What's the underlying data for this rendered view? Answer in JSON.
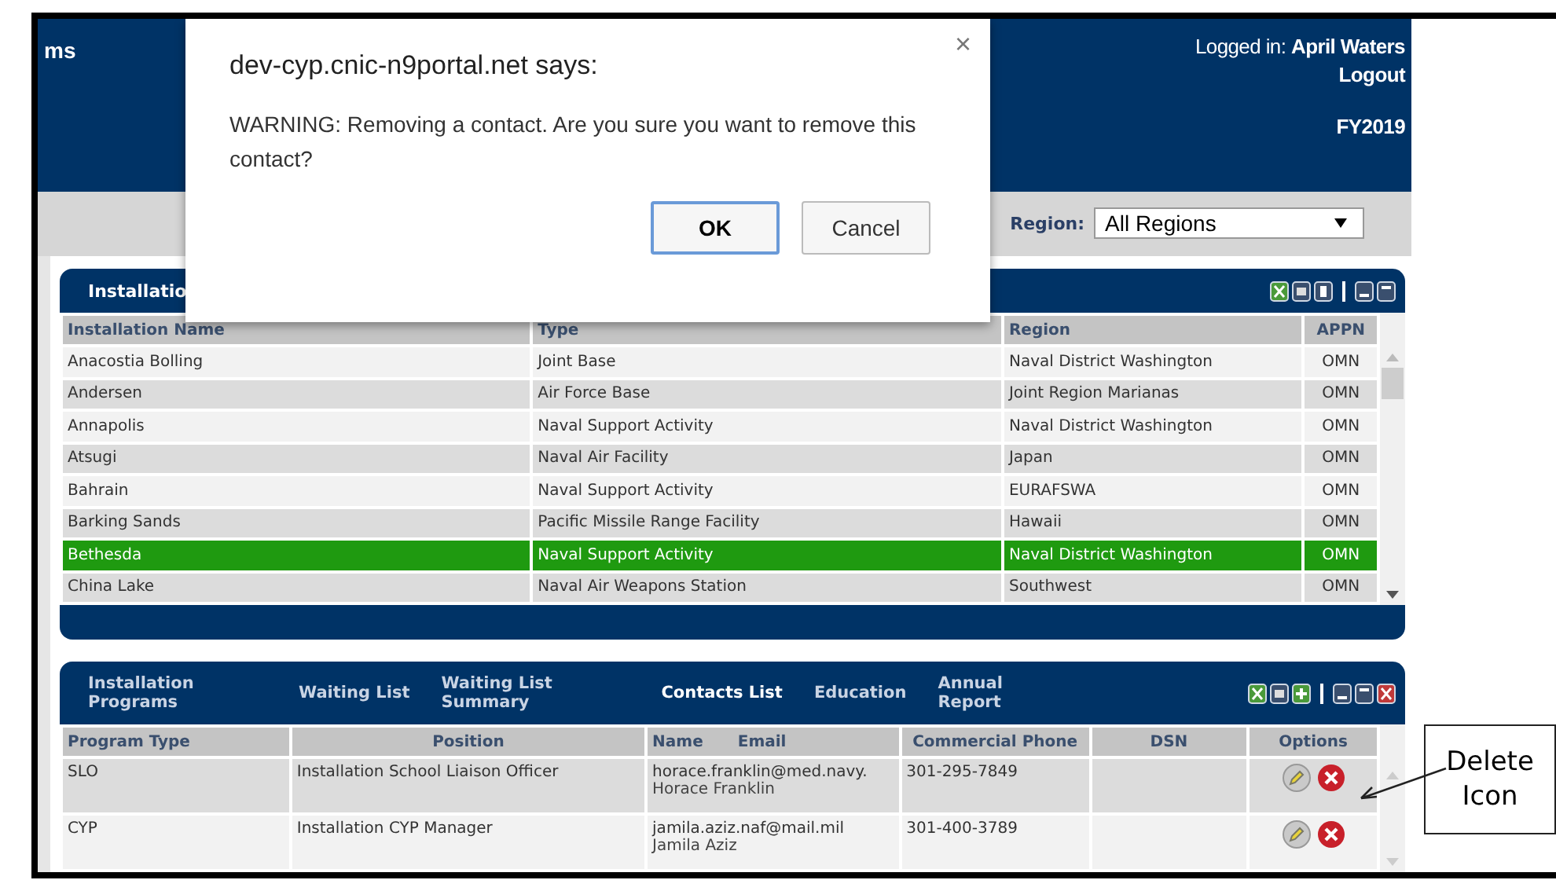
{
  "header": {
    "title_fragment": "ms",
    "logged_in_label": "Logged in:",
    "user": "April Waters",
    "logout": "Logout",
    "fiscal_year": "FY2019"
  },
  "filter": {
    "label": "Region:",
    "value": "All Regions"
  },
  "installations": {
    "tab": "Installatio",
    "columns": [
      "Installation Name",
      "Type",
      "Region",
      "APPN"
    ],
    "rows": [
      {
        "name": "Anacostia Bolling",
        "type": "Joint Base",
        "region": "Naval District Washington",
        "appn": "OMN",
        "selected": false
      },
      {
        "name": "Andersen",
        "type": "Air Force Base",
        "region": "Joint Region Marianas",
        "appn": "OMN",
        "selected": false
      },
      {
        "name": "Annapolis",
        "type": "Naval Support Activity",
        "region": "Naval District Washington",
        "appn": "OMN",
        "selected": false
      },
      {
        "name": "Atsugi",
        "type": "Naval Air Facility",
        "region": "Japan",
        "appn": "OMN",
        "selected": false
      },
      {
        "name": "Bahrain",
        "type": "Naval Support Activity",
        "region": "EURAFSWA",
        "appn": "OMN",
        "selected": false
      },
      {
        "name": "Barking Sands",
        "type": "Pacific Missile Range Facility",
        "region": "Hawaii",
        "appn": "OMN",
        "selected": false
      },
      {
        "name": "Bethesda",
        "type": "Naval Support Activity",
        "region": "Naval District Washington",
        "appn": "OMN",
        "selected": true
      },
      {
        "name": "China Lake",
        "type": "Naval Air Weapons Station",
        "region": "Southwest",
        "appn": "OMN",
        "selected": false
      }
    ]
  },
  "contacts": {
    "tabs": [
      {
        "label": "Installation Programs",
        "selected": false
      },
      {
        "label": "Waiting List",
        "selected": false
      },
      {
        "label": "Waiting List Summary",
        "selected": false
      },
      {
        "label": "Contacts List",
        "selected": true
      },
      {
        "label": "Education",
        "selected": false
      },
      {
        "label": "Annual Report",
        "selected": false
      }
    ],
    "columns": [
      "Program Type",
      "Position",
      "Name",
      "Email",
      "Commercial Phone",
      "DSN",
      "Options"
    ],
    "rows": [
      {
        "program_type": "SLO",
        "position": "Installation School Liaison Officer",
        "name": "Horace Franklin",
        "email": "horace.franklin@med.navy.",
        "phone": "301-295-7849"
      },
      {
        "program_type": "CYP",
        "position": "Installation CYP Manager",
        "name": "Jamila Aziz",
        "email": "jamila.aziz.naf@mail.mil",
        "phone": "301-400-3789"
      }
    ]
  },
  "dialog": {
    "title": "dev-cyp.cnic-n9portal.net says:",
    "message": "WARNING: Removing a contact. Are you sure you want to remove this contact?",
    "ok": "OK",
    "cancel": "Cancel",
    "close": "×"
  },
  "annotation": {
    "text": "Delete Icon"
  }
}
